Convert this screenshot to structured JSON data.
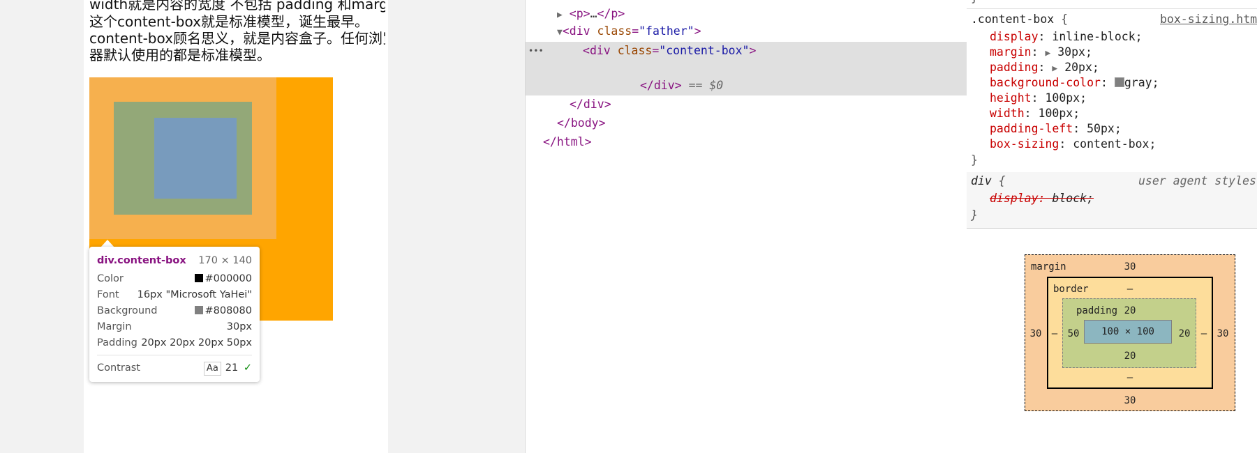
{
  "page": {
    "lines": [
      "width就是内容的宽度 不包括 padding 和margin",
      "这个content-box就是标准模型，诞生最早。",
      "content-box顾名思义，就是内容盒子。任何浏览",
      "器默认使用的都是标准模型。"
    ]
  },
  "tooltip": {
    "selector": "div.content-box",
    "size": "170 × 140",
    "rows": [
      {
        "key": "Color",
        "value": "#000000"
      },
      {
        "key": "Font",
        "value": "16px \"Microsoft YaHei\""
      },
      {
        "key": "Background",
        "value": "#808080"
      },
      {
        "key": "Margin",
        "value": "30px"
      },
      {
        "key": "Padding",
        "value": "20px 20px 20px 50px"
      }
    ],
    "contrast": {
      "label": "Contrast",
      "sample": "Aa",
      "value": "21",
      "check": "✓"
    }
  },
  "colors": {
    "swatch_color": "#000000",
    "swatch_bg": "#808080",
    "page_orange": "#ffa500"
  },
  "elements": {
    "p_open": "p",
    "p_ellipsis": "…",
    "father_tag": "div",
    "father_attr": "class",
    "father_value": "\"father\"",
    "selected_tag": "div",
    "selected_attr": "class",
    "selected_value": "\"content-box\"",
    "selected_marker": "== $0",
    "div_close": "div",
    "body_close": "body",
    "html_close": "html",
    "dots": "•••"
  },
  "styles": {
    "rule1": {
      "selector": ".content-box",
      "source": "box-sizing.htm",
      "declarations": [
        {
          "prop": "display",
          "value": "inline-block;"
        },
        {
          "prop": "margin",
          "value": "30px;",
          "expand": true
        },
        {
          "prop": "padding",
          "value": "20px;",
          "expand": true
        },
        {
          "prop": "background-color",
          "value": "gray;",
          "swatch": true
        },
        {
          "prop": "height",
          "value": "100px;"
        },
        {
          "prop": "width",
          "value": "100px;"
        },
        {
          "prop": "padding-left",
          "value": "50px;"
        },
        {
          "prop": "box-sizing",
          "value": "content-box;"
        }
      ]
    },
    "rule2": {
      "selector": "div",
      "source": "user agent styles",
      "declarations": [
        {
          "prop": "display",
          "value": "block;",
          "overridden": true
        }
      ]
    }
  },
  "box_model": {
    "margin_label": "margin",
    "margin_top": "30",
    "margin_bottom": "30",
    "margin_left": "30",
    "margin_right": "30",
    "border_label": "border",
    "border_top": "–",
    "border_bottom": "–",
    "border_left": "–",
    "border_right": "–",
    "padding_label": "padding",
    "padding_top": "20",
    "padding_bottom": "20",
    "padding_left": "50",
    "padding_right": "20",
    "content": "100 × 100"
  }
}
